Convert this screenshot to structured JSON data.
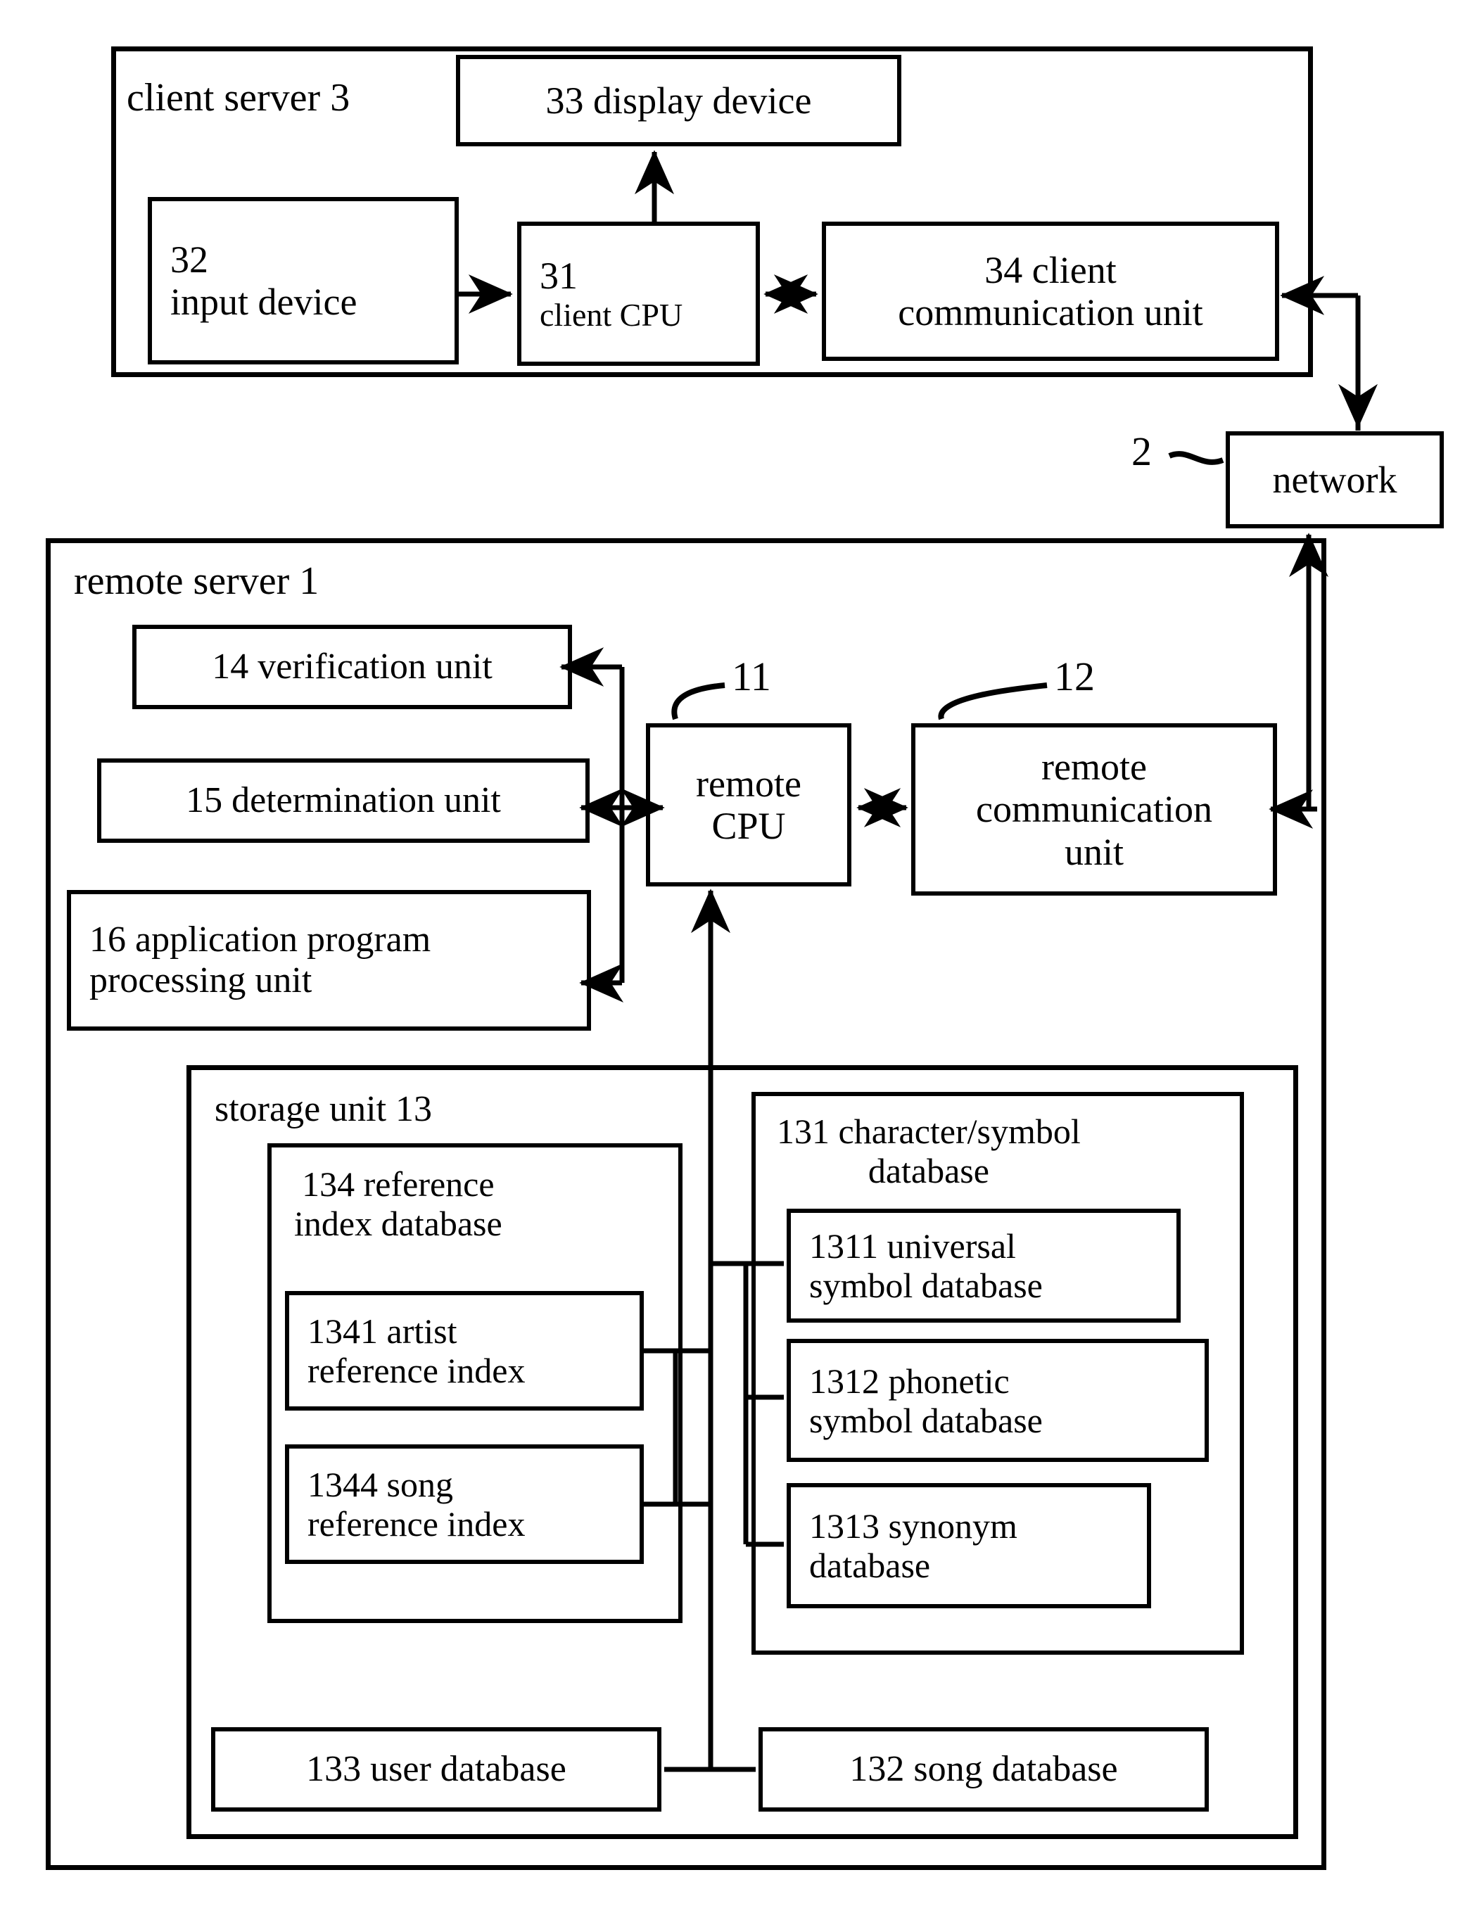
{
  "figure": {
    "type": "patent-block-diagram",
    "title": "client-server / remote-server system block diagram"
  },
  "client_server": {
    "label": "client server 3",
    "display_device": "33 display device",
    "input_device_num": "32",
    "input_device_name": "input device",
    "client_cpu_num": "31",
    "client_cpu_name": "client CPU",
    "client_comm": "34 client\ncommunication unit"
  },
  "network": {
    "ref": "2",
    "label": "network"
  },
  "remote_server": {
    "label": "remote server 1",
    "verification_unit": "14 verification unit",
    "determination_unit": "15 determination unit",
    "application_unit": "16 application program\nprocessing unit",
    "remote_cpu_ref": "11",
    "remote_cpu": "remote\nCPU",
    "remote_comm_ref": "12",
    "remote_comm": "remote\ncommunication\nunit"
  },
  "storage_unit": {
    "label": "storage unit 13",
    "reference_index_db": "134 reference\nindex database",
    "artist_reference_index": "1341 artist\nreference index",
    "song_reference_index": "1344 song\nreference index",
    "character_symbol_db": "131 character/symbol\ndatabase",
    "universal_symbol_db": "1311 universal\nsymbol database",
    "phonetic_symbol_db": "1312 phonetic\nsymbol database",
    "synonym_db": "1313 synonym\ndatabase",
    "user_db": "133 user database",
    "song_db": "132 song database"
  },
  "style": {
    "line_color": "#000000",
    "background": "#ffffff"
  }
}
